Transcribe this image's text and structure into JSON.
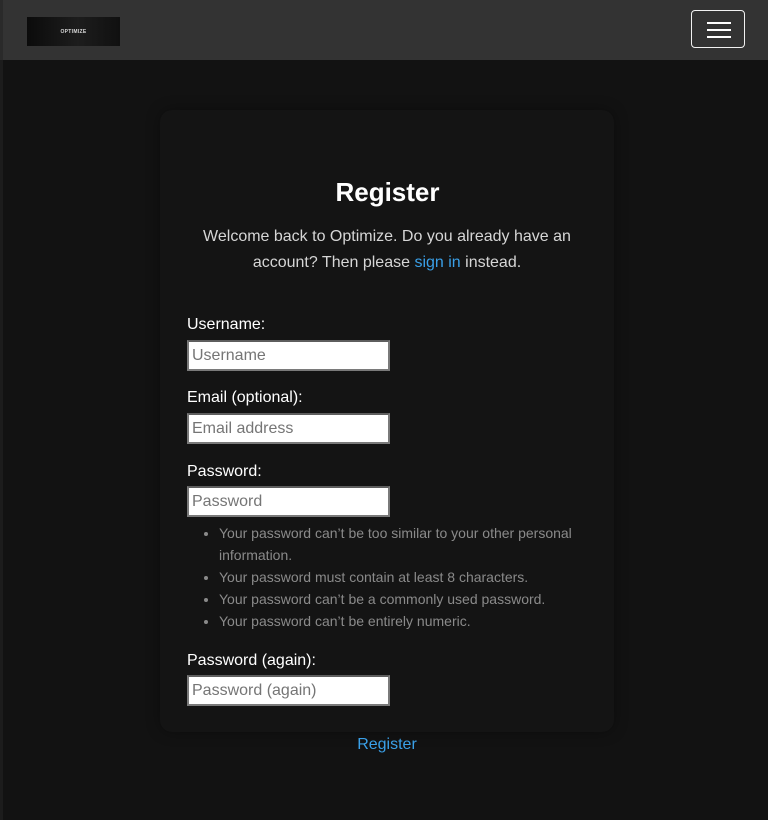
{
  "navbar": {
    "brand_text": "OPTIMIZE",
    "toggle_icon": "hamburger-menu-icon"
  },
  "form": {
    "title": "Register",
    "intro_before": "Welcome back to Optimize. Do you already have an account? Then please ",
    "intro_link": "sign in",
    "intro_after": " instead.",
    "fields": [
      {
        "label": "Username:",
        "placeholder": "Username",
        "value": ""
      },
      {
        "label": "Email (optional):",
        "placeholder": "Email address",
        "value": ""
      },
      {
        "label": "Password:",
        "placeholder": "Password",
        "value": ""
      },
      {
        "label": "Password (again):",
        "placeholder": "Password (again)",
        "value": ""
      }
    ],
    "password_help": [
      "Your password can’t be too similar to your other personal information.",
      "Your password must contain at least 8 characters.",
      "Your password can’t be a commonly used password.",
      "Your password can’t be entirely numeric."
    ],
    "submit_label": "Register"
  },
  "colors": {
    "background": "#121212",
    "navbar": "#333333",
    "link": "#3aa0e8",
    "help_text": "#8a8a8a"
  }
}
